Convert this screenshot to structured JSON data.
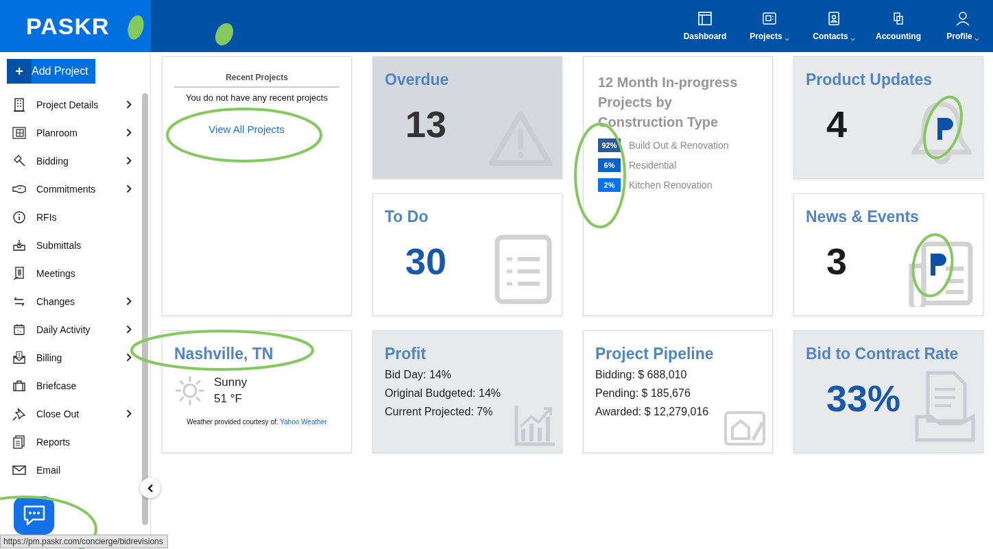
{
  "header": {
    "logo": "PASKR",
    "nav": [
      {
        "label": "Dashboard",
        "dropdown": false
      },
      {
        "label": "Projects",
        "dropdown": true
      },
      {
        "label": "Contacts",
        "dropdown": true
      },
      {
        "label": "Accounting",
        "dropdown": false
      },
      {
        "label": "Profile",
        "dropdown": true
      }
    ]
  },
  "sidebar": {
    "add_button": {
      "icon": "+",
      "label": "Add Project"
    },
    "items": [
      {
        "label": "Project Details",
        "submenu": true
      },
      {
        "label": "Planroom",
        "submenu": true
      },
      {
        "label": "Bidding",
        "submenu": true
      },
      {
        "label": "Commitments",
        "submenu": true
      },
      {
        "label": "RFIs",
        "submenu": false
      },
      {
        "label": "Submittals",
        "submenu": false
      },
      {
        "label": "Meetings",
        "submenu": false
      },
      {
        "label": "Changes",
        "submenu": true
      },
      {
        "label": "Daily Activity",
        "submenu": true
      },
      {
        "label": "Billing",
        "submenu": true
      },
      {
        "label": "Briefcase",
        "submenu": false
      },
      {
        "label": "Close Out",
        "submenu": true
      },
      {
        "label": "Reports",
        "submenu": false
      },
      {
        "label": "Email",
        "submenu": false
      }
    ]
  },
  "cards": [
    {
      "kind": "recent",
      "title": "Recent Projects",
      "message": "You do not have any recent projects",
      "link": "View All Projects"
    },
    {
      "kind": "stat",
      "title": "Overdue",
      "value": "13",
      "shaded": true,
      "alert": true,
      "accent": false
    },
    {
      "kind": "breakdown",
      "title": "12 Month In-progress Projects by Construction Type",
      "items": [
        {
          "share": "92%",
          "label": "Build Out & Renovation",
          "color": "#2b5a92"
        },
        {
          "share": "6%",
          "label": "Residential",
          "color": "#0a63c9"
        },
        {
          "share": "2%",
          "label": "Kitchen Renovation",
          "color": "#0b72ee"
        }
      ]
    },
    {
      "kind": "stat",
      "title": "Product Updates",
      "value": "4",
      "shaded": true,
      "alert": false,
      "accent": false
    },
    {
      "kind": "stat",
      "title": "To Do",
      "value": "30",
      "shaded": false,
      "alert": false,
      "accent": true
    },
    {
      "kind": "stat",
      "title": "News & Events",
      "value": "3",
      "shaded": false,
      "alert": false,
      "accent": false
    },
    {
      "kind": "weather",
      "city": "Nashville, TN",
      "condition": "Sunny",
      "temperature": "51 °F",
      "credit": "Weather provided courtesy of:",
      "credit_link": "Yahoo Weather"
    },
    {
      "kind": "lines",
      "title": "Profit",
      "lines": [
        "Bid Day: 14%",
        "Original Budgeted: 14%",
        "Current Projected: 7%"
      ],
      "shaded": true
    },
    {
      "kind": "lines",
      "title": "Project Pipeline",
      "lines": [
        "Bidding: $ 688,010",
        "Pending: $ 185,676",
        "Awarded: $ 12,279,016"
      ],
      "shaded": false
    },
    {
      "kind": "stat",
      "title": "Bid to Contract Rate",
      "value": "33%",
      "shaded": true,
      "alert": false,
      "accent": true
    }
  ],
  "status_url": "https://pm.paskr.com/concierge/bidrevisions"
}
